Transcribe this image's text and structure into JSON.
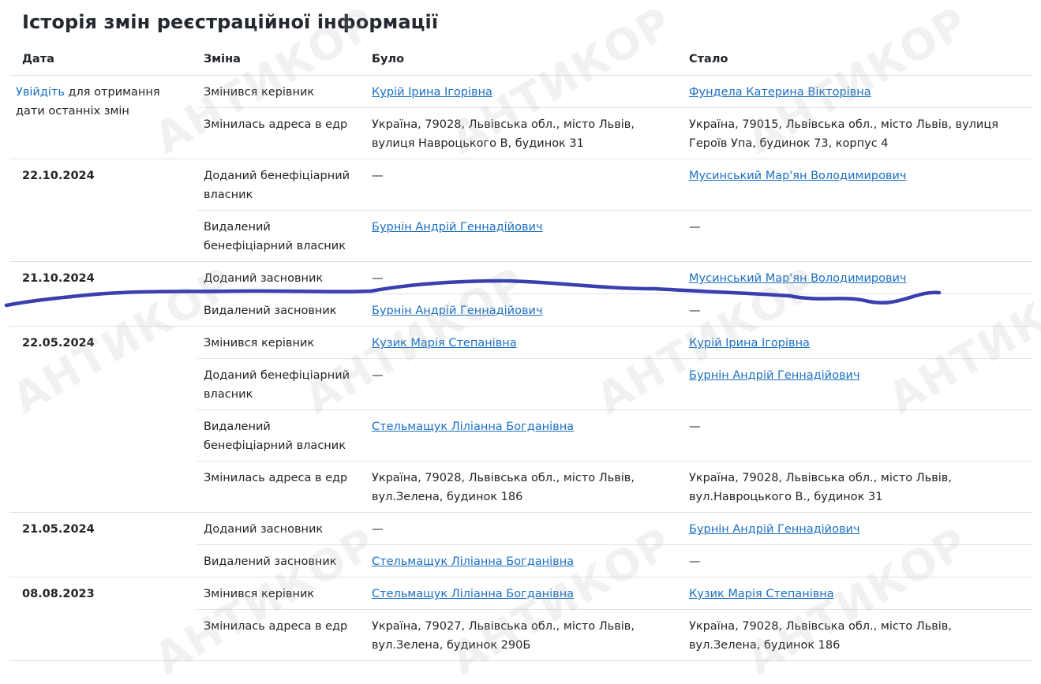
{
  "page": {
    "title": "Історія змін реєстраційної інформації"
  },
  "table": {
    "headers": [
      "Дата",
      "Зміна",
      "Було",
      "Стало"
    ],
    "login_link": "Увійдіть",
    "login_suffix": "для отримання дати останніх змін",
    "groups": [
      {
        "date": "",
        "rows": [
          {
            "change": "Змінився керівник",
            "before": "Курій Ірина Ігорівна",
            "before_link": true,
            "after": "Фундела Катерина Вікторівна",
            "after_link": true
          },
          {
            "change": "Змінилась адреса в едр",
            "before": "Україна, 79028, Львівська обл., місто Львів, вулиця Навроцького В, будинок 31",
            "before_link": false,
            "after": "Україна, 79015, Львівська обл., місто Львів, вулиця Героїв Упа, будинок 73, корпус 4",
            "after_link": false
          }
        ]
      },
      {
        "date": "22.10.2024",
        "rows": [
          {
            "change": "Доданий бенефіціарний власник",
            "before": "—",
            "before_link": false,
            "after": "Мусинський Мар'ян Володимирович",
            "after_link": true
          },
          {
            "change": "Видалений бенефіціарний власник",
            "before": "Бурнін Андрій Геннадійович",
            "before_link": true,
            "after": "—",
            "after_link": false
          }
        ]
      },
      {
        "date": "21.10.2024",
        "rows": [
          {
            "change": "Доданий засновник",
            "before": "—",
            "before_link": false,
            "after": "Мусинський Мар'ян Володимирович",
            "after_link": true
          },
          {
            "change": "Видалений засновник",
            "before": "Бурнін Андрій Геннадійович",
            "before_link": true,
            "after": "—",
            "after_link": false
          }
        ]
      },
      {
        "date": "22.05.2024",
        "rows": [
          {
            "change": "Змінився керівник",
            "before": "Кузик Марія Степанівна",
            "before_link": true,
            "after": "Курій Ірина Ігорівна",
            "after_link": true
          },
          {
            "change": "Доданий бенефіціарний власник",
            "before": "—",
            "before_link": false,
            "after": "Бурнін Андрій Геннадійович",
            "after_link": true
          },
          {
            "change": "Видалений бенефіціарний власник",
            "before": "Стельмащук Ліліанна Богданівна",
            "before_link": true,
            "after": "—",
            "after_link": false
          },
          {
            "change": "Змінилась адреса в едр",
            "before": "Україна, 79028, Львівська обл., місто Львів, вул.Зелена, будинок 186",
            "before_link": false,
            "after": "Україна, 79028, Львівська обл., місто Львів, вул.Навроцького В., будинок 31",
            "after_link": false
          }
        ]
      },
      {
        "date": "21.05.2024",
        "rows": [
          {
            "change": "Доданий засновник",
            "before": "—",
            "before_link": false,
            "after": "Бурнін Андрій Геннадійович",
            "after_link": true
          },
          {
            "change": "Видалений засновник",
            "before": "Стельмащук Ліліанна Богданівна",
            "before_link": true,
            "after": "—",
            "after_link": false
          }
        ]
      },
      {
        "date": "08.08.2023",
        "rows": [
          {
            "change": "Змінився керівник",
            "before": "Стельмащук Ліліанна Богданівна",
            "before_link": true,
            "after": "Кузик Марія Степанівна",
            "after_link": true
          },
          {
            "change": "Змінилась адреса в едр",
            "before": "Україна, 79027, Львівська обл., місто Львів, вул.Зелена, будинок 290Б",
            "before_link": false,
            "after": "Україна, 79028, Львівська обл., місто Львів, вул.Зелена, будинок 186",
            "after_link": false
          }
        ]
      }
    ]
  },
  "watermark": {
    "text": "АНТИКОР"
  },
  "colors": {
    "link": "#1a6fc4",
    "scribble": "#3a3fb0",
    "border": "#dee2e6"
  }
}
